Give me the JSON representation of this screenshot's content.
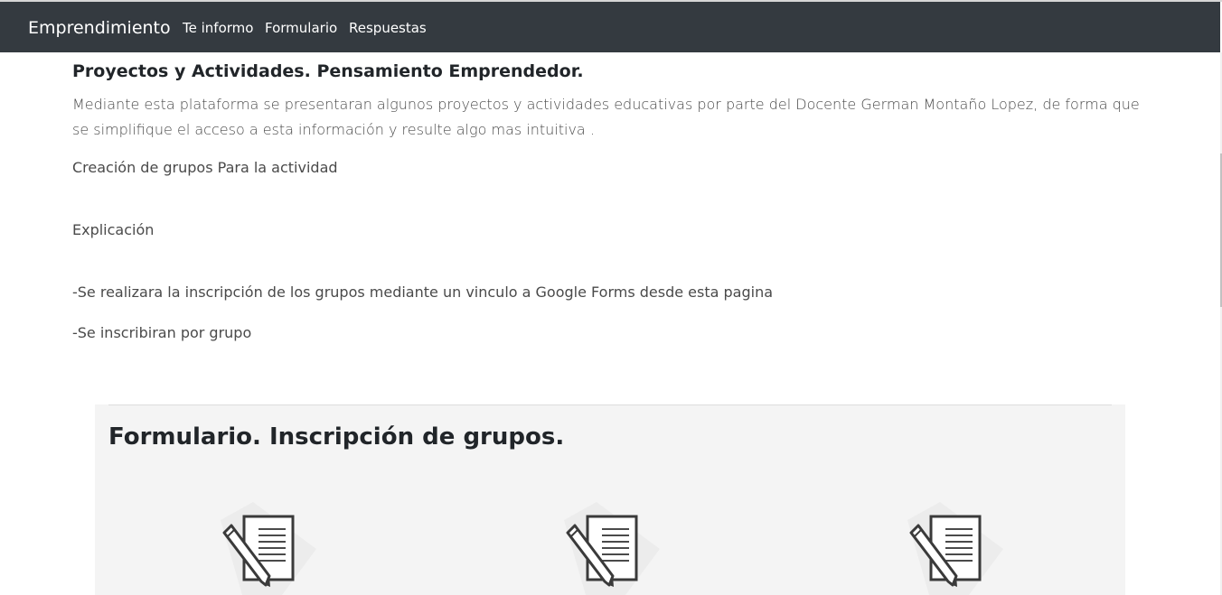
{
  "navbar": {
    "brand": "Emprendimiento",
    "links": [
      "Te informo",
      "Formulario",
      "Respuestas"
    ]
  },
  "intro": {
    "title": "Proyectos y Actividades. Pensamiento Emprendedor.",
    "lead": "Mediante esta plataforma se presentaran algunos proyectos y actividades educativas por parte del Docente German Montaño Lopez, de forma que se simplifique el acceso a esta información y resulte algo mas intuitiva .",
    "paragraphs": [
      "Creación de grupos Para la actividad",
      "Explicación",
      "-Se realizara la inscripción de los grupos mediante un vinculo a Google Forms desde esta pagina",
      "-Se inscribiran por grupo"
    ]
  },
  "form_section": {
    "title": "Formulario. Inscripción de grupos.",
    "cards": [
      {
        "icon": "form-document-pencil-icon"
      },
      {
        "icon": "form-document-pencil-icon"
      },
      {
        "icon": "form-document-pencil-icon"
      }
    ]
  }
}
